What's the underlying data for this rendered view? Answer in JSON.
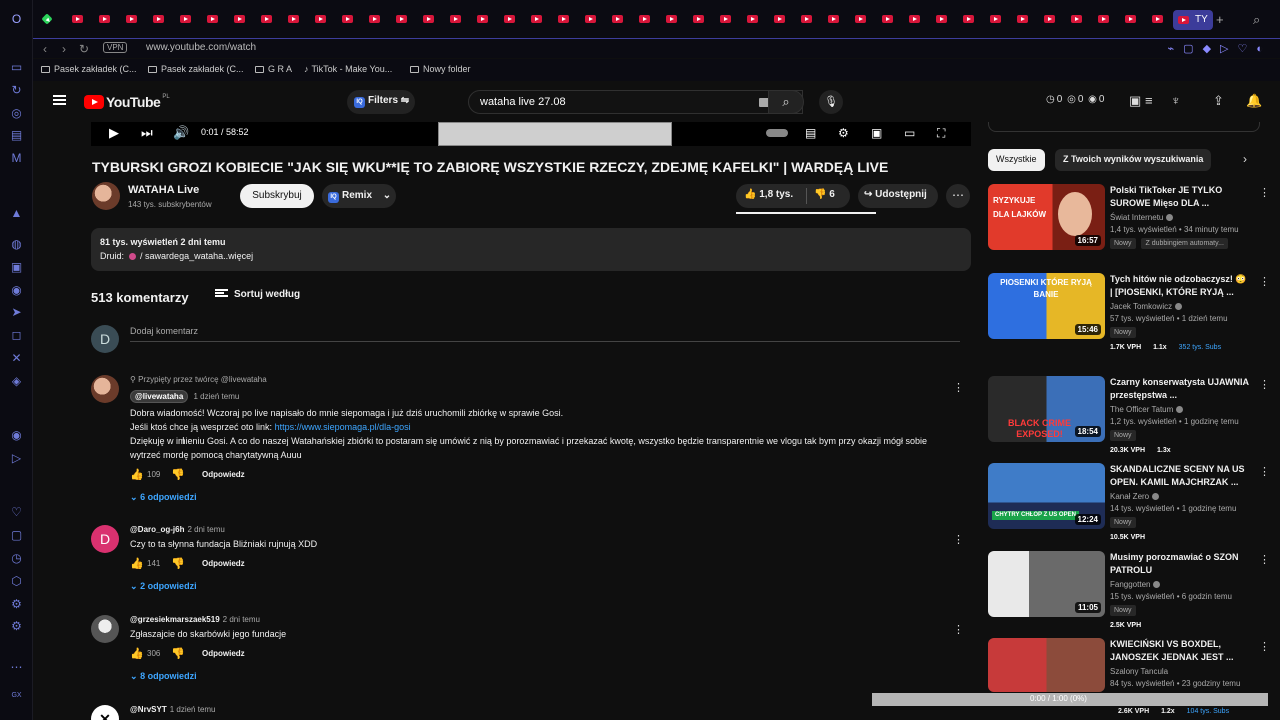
{
  "browser": {
    "active_tab_label": "TY",
    "url": "www.youtube.com/watch",
    "vpn_label": "VPN",
    "bookmarks": [
      "Pasek zakładek (C...",
      "Pasek zakładek (C...",
      "G R A",
      "TikTok - Make You...",
      "Nowy folder"
    ]
  },
  "masthead": {
    "logo_text": "YouTube",
    "country_code": "PL",
    "filters_label": "Filters",
    "search_query": "wataha live 27.08",
    "counters": [
      "0",
      "0",
      "0"
    ]
  },
  "player": {
    "time": "0:01 / 58:52"
  },
  "video": {
    "title": "TYBURSKI GROZI KOBIECIE \"JAK SIĘ WKU**IĘ TO ZABIORĘ WSZYSTKIE RZECZY, ZDEJMĘ KAFELKI\" | WARDĘĄ LIVE",
    "channel_name": "WATAHA Live",
    "channel_subs": "143 tys. subskrybentów",
    "subscribe_label": "Subskrybuj",
    "remix_label": "Remix",
    "likes": "1,8 tys.",
    "dislikes": "6",
    "share_label": "Udostępnij"
  },
  "description": {
    "meta": "81 tys. wyświetleń  2 dni temu",
    "line_prefix": "Druid:",
    "line_text": "/ sawardega_wataha..więcej"
  },
  "comments_section": {
    "count": "513 komentarzy",
    "sort_label": "Sortuj według",
    "add_avatar_letter": "D",
    "add_placeholder": "Dodaj komentarz"
  },
  "comments": [
    {
      "pinned": "Przypięty przez twórcę @livewataha",
      "author": "@livewataha",
      "time": "1 dzień temu",
      "line1": "Dobra wiadomość! Wczoraj po live napisało do mnie siepomaga i już dziś uruchomili zbiórkę w sprawie Gosi.",
      "line2_prefix": "Jeśli ktoś chce ją wesprzeć oto link: ",
      "line2_link": "https://www.siepomaga.pl/dla-gosi",
      "line3": "Dziękuję w imieniu Gosi. A co do naszej Watahańskiej zbiórki to postaram się umówić z nią by porozmawiać i przekazać kwotę, wszystko będzie transparentnie we vlogu tak bym przy okazji mógł sobie wytrzeć mordę pomocą charytatywną Auuu",
      "likes": "109",
      "reply_label": "Odpowiedz",
      "replies": "6 odpowiedzi"
    },
    {
      "avatar_letter": "D",
      "author": "@Daro_og-j6h",
      "time": "2 dni temu",
      "text": "Czy to ta słynna fundacja Bliźniaki rujnują XDD",
      "likes": "141",
      "reply_label": "Odpowiedz",
      "replies": "2 odpowiedzi"
    },
    {
      "author": "@grzesiekmarszaek519",
      "time": "2 dni temu",
      "text": "Zgłaszajcie do skarbówki jego fundacje",
      "likes": "306",
      "reply_label": "Odpowiedz",
      "replies": "8 odpowiedzi"
    },
    {
      "author": "@NrvSYT",
      "time": "1 dzień temu"
    }
  ],
  "sidebar": {
    "chips": [
      "Wszystkie",
      "Z Twoich wyników wyszukiwania"
    ],
    "recommendations": [
      {
        "title": "Polski TikToker JE TYLKO SUROWE Mięso DLA ...",
        "channel": "Świat Internetu",
        "meta": "1,4 tys. wyświetleń • 34 minuty temu",
        "badges": [
          "Nowy",
          "Z dubbingiem automaty..."
        ],
        "duration": "16:57",
        "thumb_text": "RYZYKUJE DLA LAJKÓW"
      },
      {
        "title": "Tych hitów nie odzobaczysz! 😳 | [PIOSENKI, KTÓRE RYJĄ ...",
        "channel": "Jacek Tomkowicz",
        "meta": "57 tys. wyświetleń • 1 dzień temu",
        "badges": [
          "Nowy"
        ],
        "stats": [
          "1.7K VPH",
          "1.1x",
          "352 tys. Subs"
        ],
        "duration": "15:46",
        "thumb_text": "PIOSENKI KTÓRE RYJĄ BANIE"
      },
      {
        "title": "Czarny konserwatysta UJAWNIA przestępstwa ...",
        "channel": "The Officer Tatum",
        "meta": "1,2 tys. wyświetleń • 1 godzinę temu",
        "badges": [
          "Nowy"
        ],
        "stats": [
          "20.3K VPH",
          "1.3x"
        ],
        "duration": "18:54",
        "thumb_text": "BLACK CRIME EXPOSED!"
      },
      {
        "title": "SKANDALICZNE SCENY NA US OPEN. KAMIL MAJCHRZAK ...",
        "channel": "Kanał Zero",
        "meta": "14 tys. wyświetleń • 1 godzinę temu",
        "badges": [
          "Nowy"
        ],
        "stats": [
          "10.5K VPH"
        ],
        "duration": "12:24",
        "thumb_text": "CHYTRY CHŁOP Z US OPEN"
      },
      {
        "title": "Musimy porozmawiać o SZON PATROLU",
        "channel": "Fanggotten",
        "meta": "15 tys. wyświetleń • 6 godzin temu",
        "badges": [
          "Nowy"
        ],
        "stats": [
          "2.5K VPH"
        ],
        "duration": "11:05",
        "thumb_text": ""
      },
      {
        "title": "KWIECIŃSKI VS BOXDEL, JANOSZEK JEDNAK JEST ...",
        "channel": "Szalony Tancula",
        "meta": "84 tys. wyświetleń • 23 godziny temu",
        "stats": [
          "2.6K VPH",
          "1.2x",
          "104 tys. Subs"
        ],
        "duration": "",
        "thumb_text": ""
      }
    ]
  },
  "overlay": {
    "progress_text": "0:00 / 1:00 (0%)"
  },
  "colors": {
    "background": "#0f0f0f",
    "accent_red": "#ff0000",
    "link_blue": "#3ea6ff",
    "opera_accent": "#3c3c9a"
  }
}
